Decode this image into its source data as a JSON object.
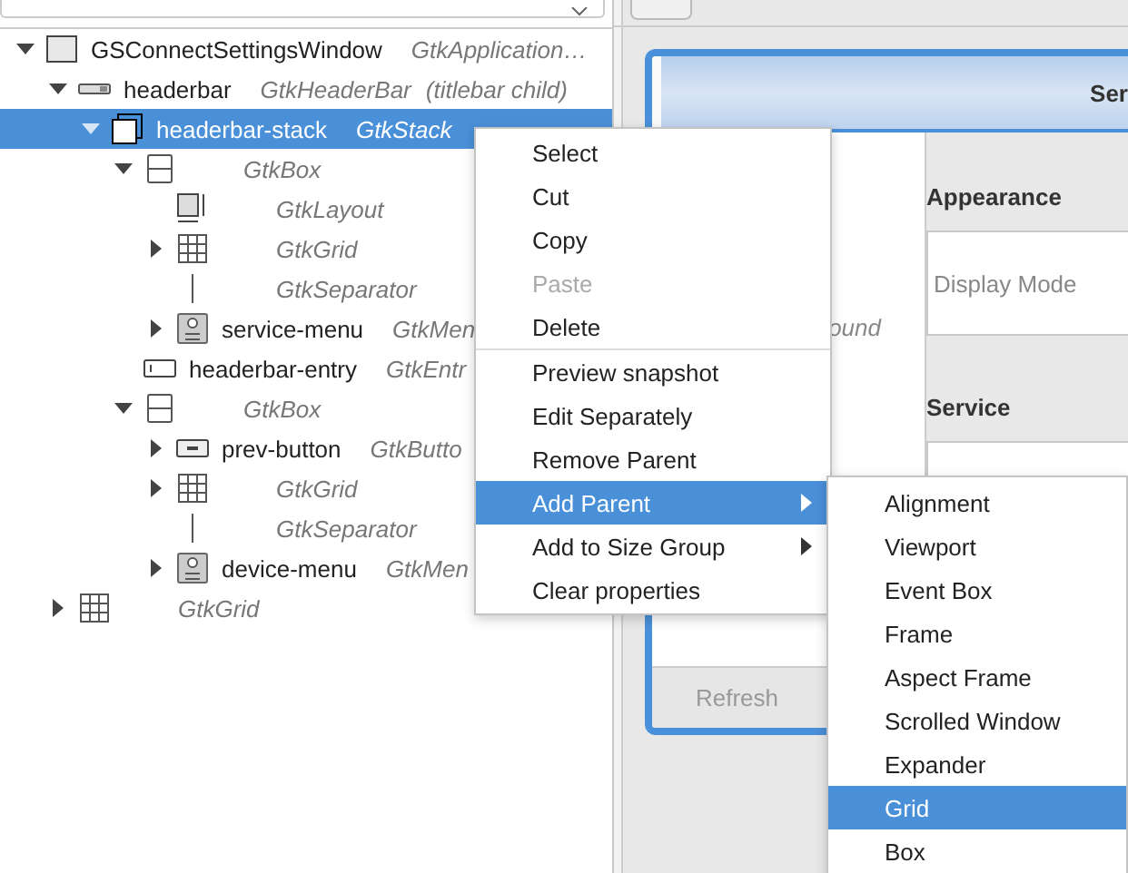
{
  "tree": [
    {
      "name": "GSConnectSettingsWindow",
      "type": "GtkApplication…",
      "kind": "window",
      "expanded": true,
      "selected": false,
      "children": [
        {
          "name": "headerbar",
          "type": "GtkHeaderBar",
          "note": "(titlebar child)",
          "kind": "headerbar",
          "expanded": true,
          "selected": false,
          "children": [
            {
              "name": "headerbar-stack",
              "type": "GtkStack",
              "kind": "stack",
              "expanded": true,
              "selected": true,
              "children": [
                {
                  "type": "GtkBox",
                  "kind": "box",
                  "expanded": true,
                  "selected": false,
                  "children": [
                    {
                      "type": "GtkLayout",
                      "kind": "layout",
                      "selected": false
                    },
                    {
                      "type": "GtkGrid",
                      "kind": "grid",
                      "expanded": false,
                      "selected": false
                    },
                    {
                      "type": "GtkSeparator",
                      "kind": "separator",
                      "selected": false
                    },
                    {
                      "name": "service-menu",
                      "type": "GtkMen",
                      "kind": "menubutton",
                      "expanded": false,
                      "selected": false
                    }
                  ]
                },
                {
                  "name": "headerbar-entry",
                  "type": "GtkEntr",
                  "kind": "entry",
                  "selected": false
                },
                {
                  "type": "GtkBox",
                  "kind": "box",
                  "expanded": true,
                  "selected": false,
                  "children": [
                    {
                      "name": "prev-button",
                      "type": "GtkButto",
                      "kind": "button",
                      "expanded": false,
                      "selected": false
                    },
                    {
                      "type": "GtkGrid",
                      "kind": "grid",
                      "expanded": false,
                      "selected": false
                    },
                    {
                      "type": "GtkSeparator",
                      "kind": "separator",
                      "selected": false
                    },
                    {
                      "name": "device-menu",
                      "type": "GtkMen",
                      "kind": "menubutton",
                      "expanded": false,
                      "selected": false
                    }
                  ]
                }
              ]
            }
          ]
        },
        {
          "type": "GtkGrid",
          "kind": "grid",
          "expanded": false,
          "selected": false
        }
      ]
    }
  ],
  "preview": {
    "header_title": "Ser",
    "sidebar_text": "ound",
    "refresh_button": "Refresh",
    "sections": [
      {
        "heading": "Appearance",
        "row": "Display Mode"
      },
      {
        "heading": "Service"
      }
    ]
  },
  "context_menu": [
    {
      "label": "Select",
      "disabled": false,
      "selected": false,
      "submenu": false,
      "divider_above": false
    },
    {
      "label": "Cut",
      "disabled": false,
      "selected": false,
      "submenu": false,
      "divider_above": false
    },
    {
      "label": "Copy",
      "disabled": false,
      "selected": false,
      "submenu": false,
      "divider_above": false
    },
    {
      "label": "Paste",
      "disabled": true,
      "selected": false,
      "submenu": false,
      "divider_above": false
    },
    {
      "label": "Delete",
      "disabled": false,
      "selected": false,
      "submenu": false,
      "divider_above": false
    },
    {
      "label": "Preview snapshot",
      "disabled": false,
      "selected": false,
      "submenu": false,
      "divider_above": true
    },
    {
      "label": "Edit Separately",
      "disabled": false,
      "selected": false,
      "submenu": false,
      "divider_above": false
    },
    {
      "label": "Remove Parent",
      "disabled": false,
      "selected": false,
      "submenu": false,
      "divider_above": false
    },
    {
      "label": "Add Parent",
      "disabled": false,
      "selected": true,
      "submenu": true,
      "divider_above": false
    },
    {
      "label": "Add to Size Group",
      "disabled": false,
      "selected": false,
      "submenu": true,
      "divider_above": false
    },
    {
      "label": "Clear properties",
      "disabled": false,
      "selected": false,
      "submenu": false,
      "divider_above": false
    }
  ],
  "submenu": [
    {
      "label": "Alignment",
      "selected": false
    },
    {
      "label": "Viewport",
      "selected": false
    },
    {
      "label": "Event Box",
      "selected": false
    },
    {
      "label": "Frame",
      "selected": false
    },
    {
      "label": "Aspect Frame",
      "selected": false
    },
    {
      "label": "Scrolled Window",
      "selected": false
    },
    {
      "label": "Expander",
      "selected": false
    },
    {
      "label": "Grid",
      "selected": true
    },
    {
      "label": "Box",
      "selected": false
    }
  ]
}
